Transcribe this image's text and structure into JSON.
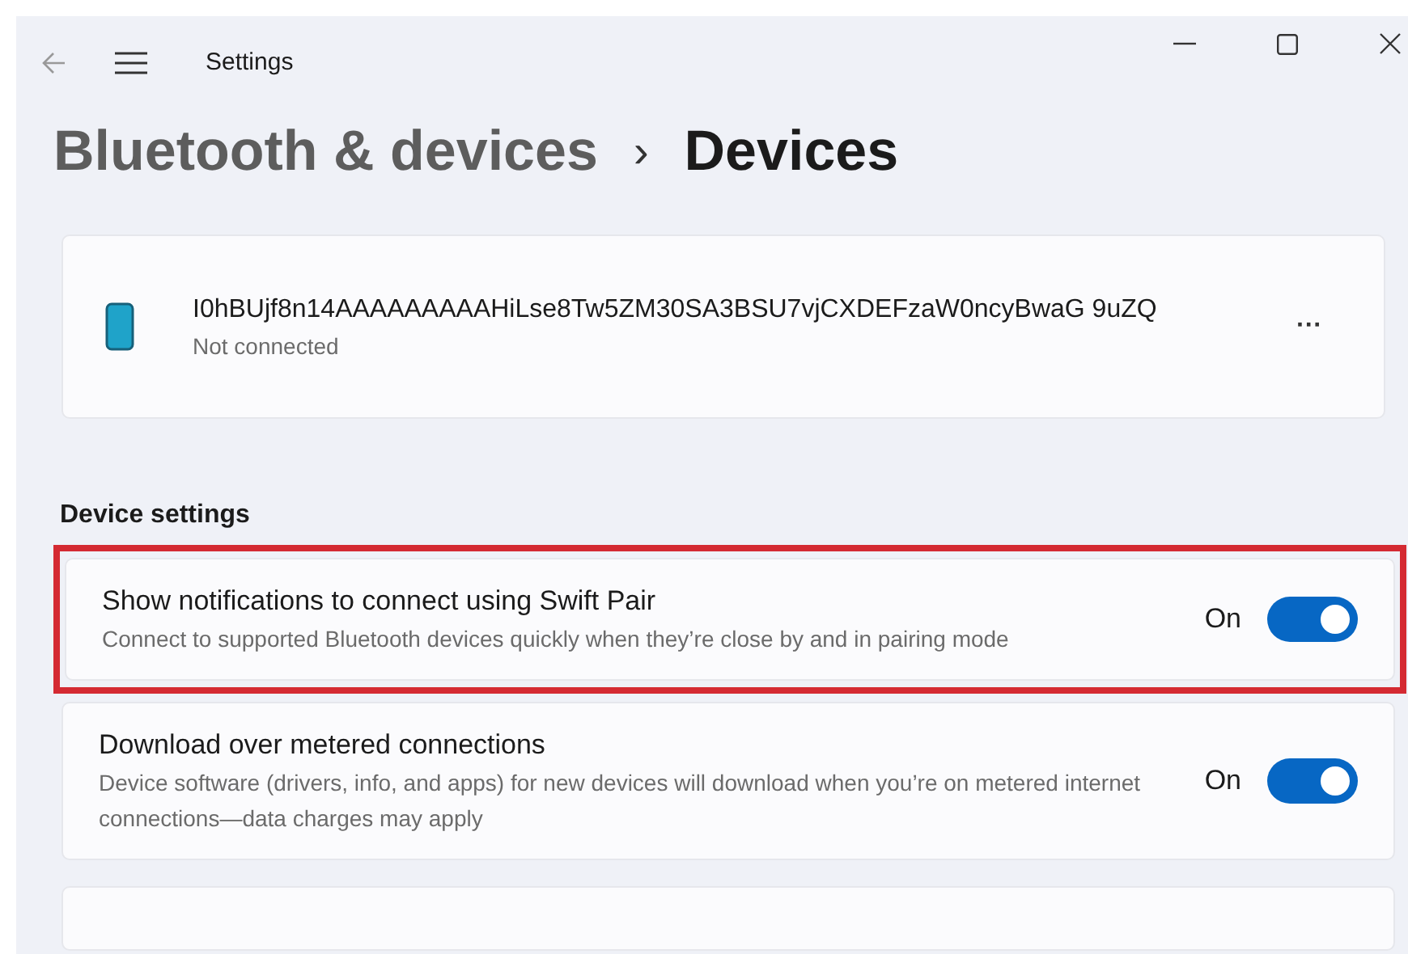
{
  "window": {
    "title": "Settings"
  },
  "breadcrumb": {
    "parent": "Bluetooth & devices",
    "separator": "›",
    "current": "Devices"
  },
  "device": {
    "name": "I0hBUjf8n14AAAAAAAAAHiLse8Tw5ZM30SA3BSU7vjCXDEFzaW0ncyBwaG 9uZQ",
    "status": "Not connected",
    "more": "···"
  },
  "section_title": "Device settings",
  "settings": [
    {
      "title": "Show notifications to connect using Swift Pair",
      "description": "Connect to supported Bluetooth devices quickly when they’re close by and in pairing mode",
      "state_label": "On",
      "on": true,
      "highlighted": true
    },
    {
      "title": "Download over metered connections",
      "description": "Device software (drivers, info, and apps) for new devices will download when you’re on metered internet connections—data charges may apply",
      "state_label": "On",
      "on": true,
      "highlighted": false
    }
  ]
}
